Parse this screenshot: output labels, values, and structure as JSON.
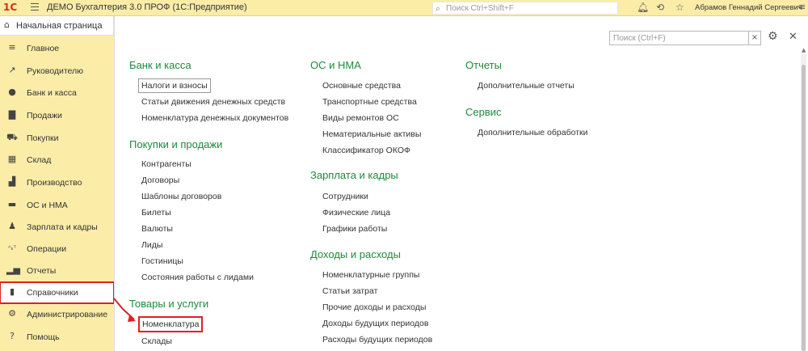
{
  "topbar": {
    "app_title": "ДЕМО Бухгалтерия 3.0 ПРОФ  (1С:Предприятие)",
    "search_placeholder": "Поиск Ctrl+Shift+F",
    "user_name": "Абрамов Геннадий Сергеевич",
    "logo_text": "1С"
  },
  "sidebar": {
    "home_label": "Начальная страница",
    "items": [
      {
        "label": "Главное",
        "icon": "menu-lines-icon"
      },
      {
        "label": "Руководителю",
        "icon": "trend-icon"
      },
      {
        "label": "Банк и касса",
        "icon": "coin-icon"
      },
      {
        "label": "Продажи",
        "icon": "bag-icon"
      },
      {
        "label": "Покупки",
        "icon": "cart-icon"
      },
      {
        "label": "Склад",
        "icon": "warehouse-icon"
      },
      {
        "label": "Производство",
        "icon": "factory-icon"
      },
      {
        "label": "ОС и НМА",
        "icon": "truck-icon"
      },
      {
        "label": "Зарплата и кадры",
        "icon": "person-icon"
      },
      {
        "label": "Операции",
        "icon": "operations-icon"
      },
      {
        "label": "Отчеты",
        "icon": "bar-chart-icon"
      },
      {
        "label": "Справочники",
        "icon": "book-icon"
      },
      {
        "label": "Администрирование",
        "icon": "gear-icon"
      },
      {
        "label": "Помощь",
        "icon": "question-icon"
      }
    ]
  },
  "panel": {
    "search_placeholder": "Поиск (Ctrl+F)",
    "columns": [
      {
        "sections": [
          {
            "title": "Банк и касса",
            "links": [
              "Налоги и взносы",
              "Статьи движения денежных средств",
              "Номенклатура денежных документов"
            ]
          },
          {
            "title": "Покупки и продажи",
            "links": [
              "Контрагенты",
              "Договоры",
              "Шаблоны договоров",
              "Билеты",
              "Валюты",
              "Лиды",
              "Гостиницы",
              "Состояния работы с лидами"
            ]
          },
          {
            "title": "Товары и услуги",
            "links": [
              "Номенклатура",
              "Склады"
            ]
          }
        ]
      },
      {
        "sections": [
          {
            "title": "ОС и НМА",
            "links": [
              "Основные средства",
              "Транспортные средства",
              "Виды ремонтов ОС",
              "Нематериальные активы",
              "Классификатор ОКОФ"
            ]
          },
          {
            "title": "Зарплата и кадры",
            "links": [
              "Сотрудники",
              "Физические лица",
              "Графики работы"
            ]
          },
          {
            "title": "Доходы и расходы",
            "links": [
              "Номенклатурные группы",
              "Статьи затрат",
              "Прочие доходы и расходы",
              "Доходы будущих периодов",
              "Расходы будущих периодов"
            ]
          }
        ]
      },
      {
        "sections": [
          {
            "title": "Отчеты",
            "links": [
              "Дополнительные отчеты"
            ]
          },
          {
            "title": "Сервис",
            "links": [
              "Дополнительные обработки"
            ]
          }
        ]
      }
    ]
  },
  "colors": {
    "sidebar_bg": "#fbeda8",
    "section_title": "#1d8a3a",
    "highlight": "#e02020"
  }
}
